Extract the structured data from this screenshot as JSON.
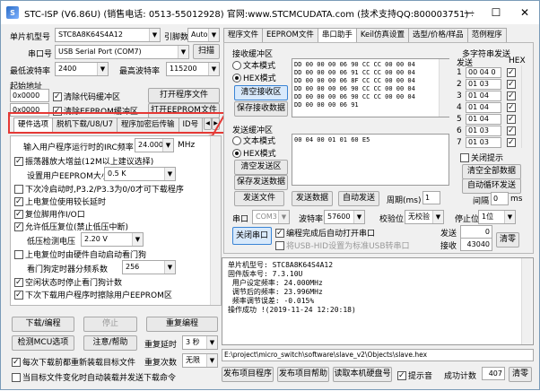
{
  "window": {
    "title": "STC-ISP (V6.86U) (销售电话: 0513-55012928) 官网:www.STCMCUDATA.com  (技术支持QQ:800003751) 本软件...",
    "min": "—",
    "max": "☐",
    "close": "✕"
  },
  "left": {
    "mcu_label": "单片机型号",
    "mcu_value": "STC8A8K64S4A12",
    "pin_label": "引脚数",
    "pin_value": "Auto",
    "port_label": "串口号",
    "port_value": "USB Serial Port (COM7)",
    "scan_btn": "扫描",
    "min_baud_label": "最低波特率",
    "min_baud_value": "2400",
    "max_baud_label": "最高波特率",
    "max_baud_value": "115200",
    "start_addr_label": "起始地址",
    "addr1": "0x0000",
    "clear_code": "清除代码缓冲区",
    "open_prog": "打开程序文件",
    "addr2": "0x0000",
    "clear_eeprom": "清除EEPROM缓冲区",
    "open_eeprom": "打开EEPROM文件",
    "annotation": "1",
    "tabs": [
      "硬件选项",
      "脱机下载/U8/U7",
      "程序加密后传输",
      "ID号"
    ],
    "opts": {
      "freq_label": "输入用户程序运行时的IRC频率",
      "freq_value": "24.000",
      "freq_unit": "MHz",
      "amp": "振荡器放大增益(12M以上建议选择)",
      "eeprom_size_label": "设置用户EEPROM大小",
      "eeprom_size_value": "0.5 K",
      "p32": "下次冷启动时,P3.2/P3.3为0/0才可下载程序",
      "delay": "上电复位使用较长延时",
      "reset_io": "复位脚用作I/O口",
      "lvd": "允许低压复位(禁止低压中断)",
      "lvd_label": "低压检测电压",
      "lvd_value": "2.20 V",
      "wdt": "上电复位时由硬件自动启动看门狗",
      "wdt_div_label": "看门狗定时器分频系数",
      "wdt_div_value": "256",
      "idle": "空闲状态时停止看门狗计数",
      "erase": "下次下载用户程序时擦除用户EEPROM区"
    },
    "download_btn": "下载/编程",
    "stop_btn": "停止",
    "reprog_btn": "重复编程",
    "detect_btn": "检测MCU选项",
    "help_btn": "注意/帮助",
    "retry_delay_label": "重复延时",
    "retry_delay_value": "3 秒",
    "reload_chk": "每次下载前都重新装载目标文件",
    "retry_count_label": "重复次数",
    "retry_count_value": "无限",
    "auto_send_chk": "当目标文件变化时自动装载并发送下载命令"
  },
  "right": {
    "tabs": [
      "程序文件",
      "EEPROM文件",
      "串口助手",
      "Keil仿真设置",
      "选型/价格/样品",
      "范例程序"
    ],
    "recv_label": "接收缓冲区",
    "text_mode": "文本模式",
    "hex_mode": "HEX模式",
    "clear_recv": "清空接收区",
    "save_recv": "保存接收数据",
    "recv_lines": [
      "DD 00 00 00 06 90 CC CC 00 00 04",
      "DD 00 00 00 06 91 CC CC 00 00 04",
      "DD 00 00 00 06 8F CC CC 00 00 04",
      "DD 00 00 00 06 90 CC CC 00 00 04",
      "DD 00 00 00 06 90 CC CC 00 00 04",
      "DD 00 00 00 06 91"
    ],
    "send_label": "发送缓冲区",
    "send_text_mode": "文本模式",
    "send_hex_mode": "HEX模式",
    "clear_send": "清空发送区",
    "save_send": "保存发送数据",
    "send_data": "00 04 00 01 01 60 E5",
    "send_file": "发送文件",
    "send_data_btn": "发送数据",
    "auto_send": "自动发送",
    "period_label": "周期(ms)",
    "period_value": "1",
    "port_label": "串口",
    "port_value": "COM3",
    "baud_label": "波特率",
    "baud_value": "57600",
    "parity_label": "校验位",
    "parity_value": "无校验",
    "stop_label": "停止位",
    "stop_value": "1位",
    "open_port": "关闭串口",
    "auto_open": "编程完成后自动打开串口",
    "usb_cdc": "将USB-HID设置为标准USB转串口",
    "sent_label": "发送",
    "sent_value": "0",
    "recv_count_label": "接收",
    "recv_count_value": "43040",
    "clear_btn": "清零",
    "multi_label": "多字符串发送",
    "multi_send": "发送",
    "multi_hex": "HEX",
    "multi_rows": [
      {
        "idx": "1",
        "val": "00 04 0"
      },
      {
        "idx": "2",
        "val": "01 03"
      },
      {
        "idx": "3",
        "val": "01 04"
      },
      {
        "idx": "4",
        "val": "01 04"
      },
      {
        "idx": "5",
        "val": "01 04"
      },
      {
        "idx": "6",
        "val": "01 03"
      },
      {
        "idx": "7",
        "val": "01 03"
      }
    ],
    "close_tips": "关闭提示",
    "clear_all": "清空全部数据",
    "auto_loop": "自动循环发送",
    "interval_label": "间隔",
    "interval_value": "0",
    "interval_unit": "ms",
    "info_lines": [
      "单片机型号: STC8A8K64S4A12",
      "固件版本号: 7.3.10U",
      "",
      " 用户设定频率: 24.000MHz",
      " 调节后的频率: 23.996MHz",
      " 频率调节误差: -0.015%",
      "",
      "",
      "操作成功 !(2019-11-24 12:20:18)"
    ],
    "path": "E:\\project\\micro_switch\\software\\slave_v2\\Objects\\slave.hex",
    "publish_prog": "发布项目程序",
    "publish_help": "发布项目帮助",
    "read_serial": "读取本机硬盘号",
    "beep_chk": "提示音",
    "success_label": "成功计数",
    "success_value": "407",
    "clear_success": "清零"
  }
}
